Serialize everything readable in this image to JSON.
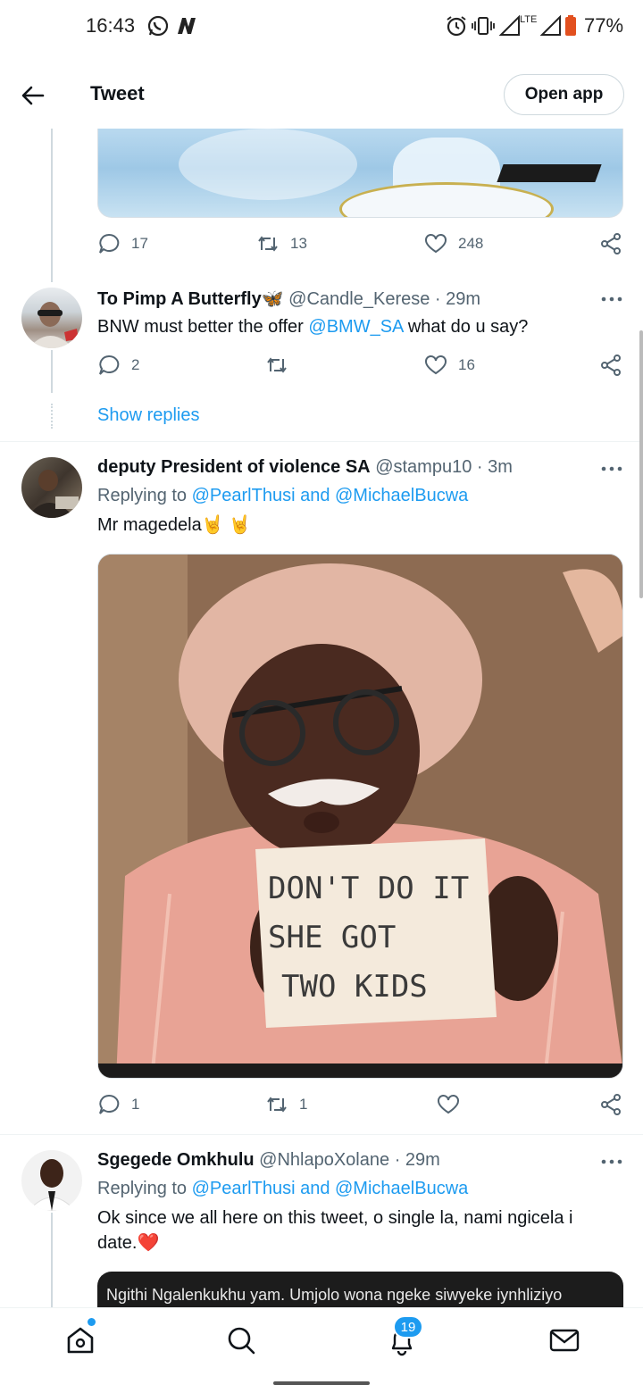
{
  "status_bar": {
    "time": "16:43",
    "battery": "77%",
    "network": "LTE"
  },
  "header": {
    "title": "Tweet",
    "open_app": "Open app"
  },
  "tweet0_actions": {
    "replies": "17",
    "retweets": "13",
    "likes": "248"
  },
  "tweet1": {
    "name": "To Pimp A Butterfly🦋",
    "handle": "@Candle_Kerese",
    "time": "· 29m",
    "text_before": "BNW must better the offer ",
    "mention": "@BMW_SA",
    "text_after": " what do u say?",
    "replies": "2",
    "retweets": "",
    "likes": "16",
    "show_replies": "Show replies"
  },
  "tweet2": {
    "name": "deputy President of violence SA",
    "handle": "@stampu10",
    "time": "· 3m",
    "replying_label": "Replying to ",
    "replying_to": "@PearlThusi and @MichaelBucwa",
    "text": "Mr magedela🤘 🤘",
    "sign_lines": [
      "DON'T DO IT",
      "SHE GOT",
      "TWO KIDS"
    ],
    "replies": "1",
    "retweets": "1",
    "likes": ""
  },
  "tweet3": {
    "name": "Sgegede Omkhulu",
    "handle": "@NhlapoXolane",
    "time": "· 29m",
    "replying_label": "Replying to ",
    "replying_to": "@PearlThusi and @MichaelBucwa",
    "text_line1": "Ok since we all here on this tweet, o single la, nami ngicela i",
    "text_line2": "date.❤️",
    "media_caption": "Ngithi Ngalenkukhu yam. Umjolo wona ngeke siwyeke iynhliziyo"
  },
  "bottom_nav": {
    "notifications_badge": "19"
  },
  "colors": {
    "accent": "#1d9bf0",
    "text": "#0f1419",
    "muted": "#536471"
  }
}
